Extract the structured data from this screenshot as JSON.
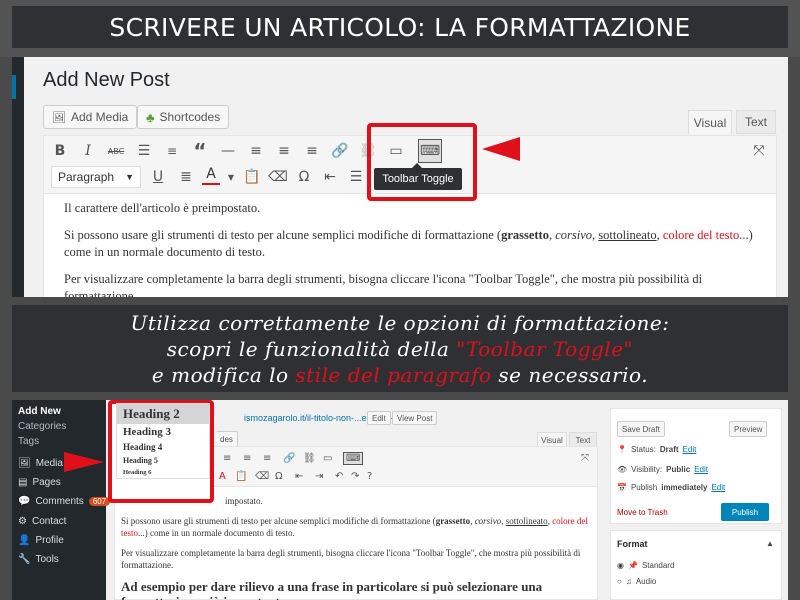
{
  "banner_top": {
    "title": "SCRIVERE UN ARTICOLO: LA FORMATTAZIONE"
  },
  "editor": {
    "page_title": "Add New Post",
    "add_media": "Add Media",
    "shortcodes": "Shortcodes",
    "tab_visual": "Visual",
    "tab_text": "Text",
    "format_select": "Paragraph",
    "tooltip": "Toolbar Toggle",
    "paragraphs": {
      "p1": "Il carattere dell'articolo è preimpostato.",
      "p2_a": "Si possono usare gli strumenti di testo per alcune semplici modifiche di formattazione (",
      "p2_bold": "grassetto",
      "p2_sep1": ", ",
      "p2_italic": "corsivo",
      "p2_sep2": ", ",
      "p2_underline": "sottolineato",
      "p2_sep3": ", ",
      "p2_color": "colore del testo",
      "p2_b": "...) come in un normale documento di testo.",
      "p3": "Per visualizzare completamente la barra degli strumenti, bisogna cliccare l'icona \"Toolbar Toggle\", che mostra più possibilità di formattazione."
    }
  },
  "banner_mid": {
    "line1": "Utilizza correttamente le opzioni di formattazione:",
    "line2_a": "scopri le funzionalità della ",
    "line2_red": "\"Toolbar Toggle\"",
    "line3_a": "e modifica lo ",
    "line3_red": "stile del paragrafo",
    "line3_b": " se necessario."
  },
  "panel2": {
    "sidebar": {
      "add_new": "Add New",
      "categories": "Categories",
      "tags": "Tags",
      "media": "Media",
      "pages": "Pages",
      "comments": "Comments",
      "comments_count": "607",
      "contact": "Contact",
      "profile": "Profile",
      "tools": "Tools"
    },
    "headings": [
      "Heading 2",
      "Heading 3",
      "Heading 4",
      "Heading 5",
      "Heading 6"
    ],
    "url": "ismozagarolo.it/il-titolo-non-...e-le-10-parole/",
    "edit_btn": "Edit",
    "view_post": "View Post",
    "add_media_frag": "des",
    "tab_visual": "Visual",
    "tab_text": "Text",
    "p_preset": "impostato.",
    "p2_a": "Si possono usare gli strumenti di testo per alcune semplici modifiche di formattazione (",
    "p2_bold": "grassetto",
    "p2_italic": "corsivo",
    "p2_underline": "sottolineato",
    "p2_color": "colore del testo",
    "p2_b": "...) come in un normale documento di testo.",
    "p3": "Per visualizzare completamente la barra degli strumenti, bisogna cliccare l'icona \"Toolbar Toggle\", che mostra più possibilità di formattazione.",
    "h3": "Ad esempio per dare rilievo a una frase in particolare si può selezionare una formattazione più importante.",
    "publish": {
      "save_draft": "Save Draft",
      "preview": "Preview",
      "status_label": "Status: ",
      "status_value": "Draft",
      "visibility_label": "Visibility: ",
      "visibility_value": "Public",
      "publish_label": "Publish ",
      "publish_value": "immediately",
      "edit": "Edit",
      "trash": "Move to Trash",
      "publish_btn": "Publish"
    },
    "format": {
      "title": "Format",
      "standard": "Standard",
      "audio": "Audio"
    }
  },
  "colors": {
    "accent_red": "#e0101a",
    "wp_blue": "#0073aa",
    "wp_dark": "#23282d"
  }
}
